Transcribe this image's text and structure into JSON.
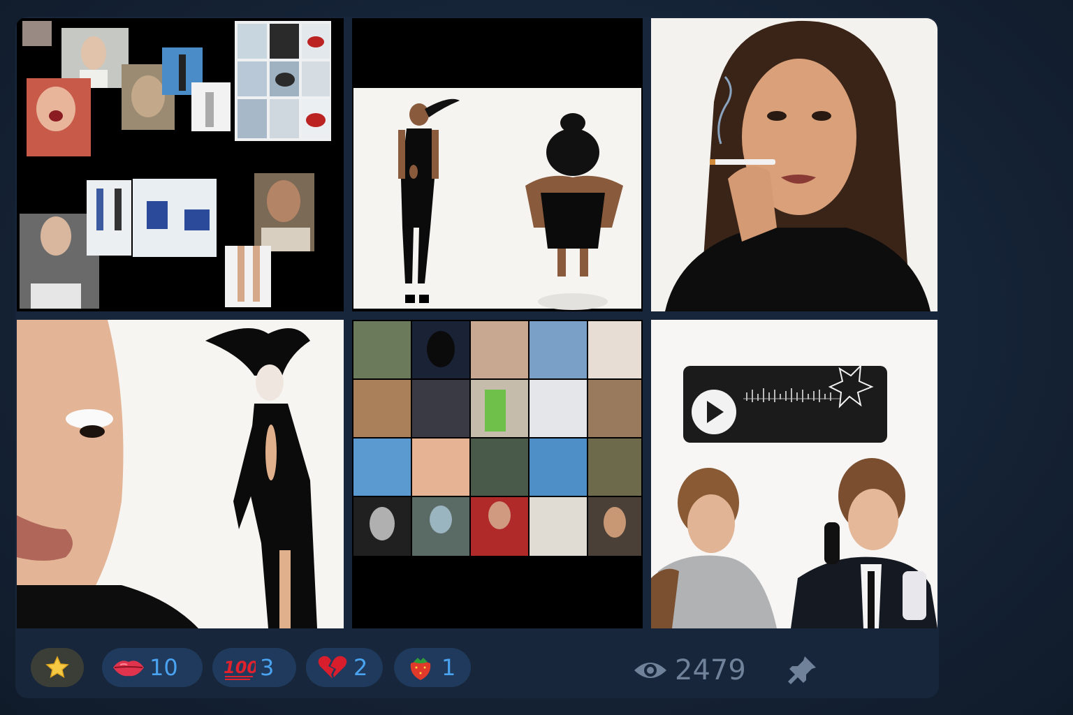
{
  "post": {
    "gallery": {
      "tiles": [
        {
          "subject": "photo-collage-mosaic"
        },
        {
          "subject": "fashion-figures-black-bodysuit"
        },
        {
          "subject": "portrait-woman-smoking"
        },
        {
          "subject": "face-closeup-and-black-gown"
        },
        {
          "subject": "grid-of-portraits"
        },
        {
          "subject": "voice-message-and-two-men-phones"
        }
      ]
    },
    "reactions": [
      {
        "icon": "lips-icon",
        "count": "10"
      },
      {
        "icon": "hundred-icon",
        "count": "3"
      },
      {
        "icon": "broken-heart-icon",
        "count": "2"
      },
      {
        "icon": "strawberry-icon",
        "count": "1"
      }
    ],
    "paid_reaction": {
      "icon": "star-icon"
    },
    "views": {
      "icon": "eye-icon",
      "count": "2479"
    },
    "pin": {
      "icon": "pin-icon"
    }
  },
  "colors": {
    "background": "#152336",
    "card": "#17263a",
    "reaction_bg": "#1f3a5c",
    "reaction_count": "#4aa3f0",
    "muted": "#6f8299"
  }
}
